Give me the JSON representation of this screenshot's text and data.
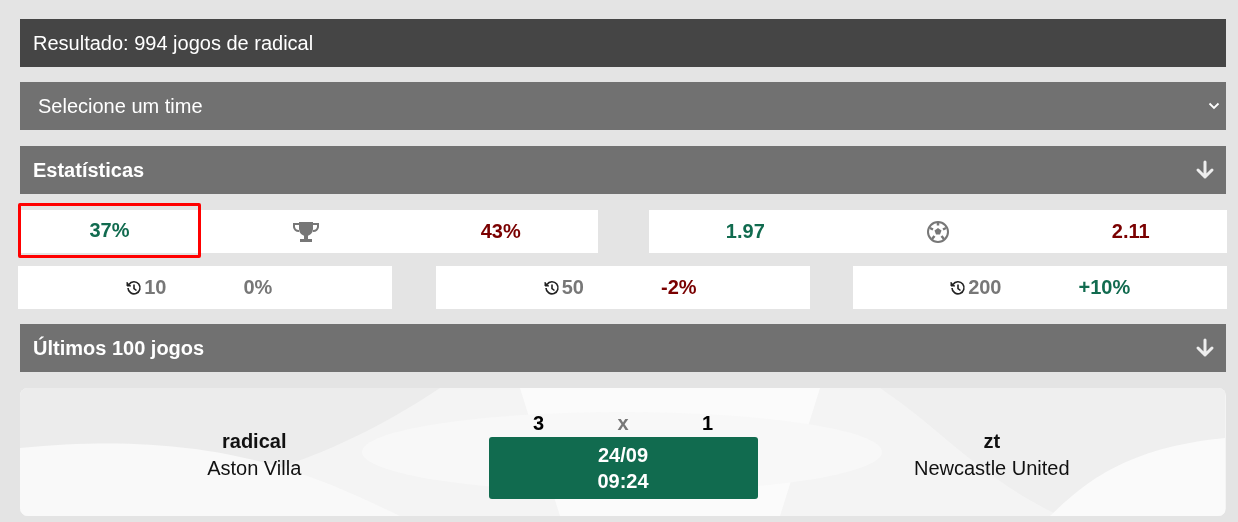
{
  "result_bar": {
    "title": "Resultado: 994 jogos de radical"
  },
  "team_select": {
    "placeholder": "Selecione um time"
  },
  "statistics": {
    "title": "Estatísticas",
    "main": [
      {
        "kind": "trophy",
        "home": {
          "value": "37%",
          "color": "#116b4f",
          "highlighted": true
        },
        "away": {
          "value": "43%",
          "color": "#7a0000",
          "highlighted": false
        }
      },
      {
        "kind": "ball",
        "home": {
          "value": "1.97",
          "color": "#116b4f",
          "highlighted": false
        },
        "away": {
          "value": "2.11",
          "color": "#7a0000",
          "highlighted": false
        }
      }
    ],
    "history": [
      {
        "label": "10",
        "value": "0%",
        "color": "#777777"
      },
      {
        "label": "50",
        "value": "-2%",
        "color": "#7a0000"
      },
      {
        "label": "200",
        "value": "+10%",
        "color": "#116b4f"
      }
    ]
  },
  "last_games": {
    "title": "Últimos 100 jogos",
    "matches": [
      {
        "home_player": "radical",
        "home_team": "Aston Villa",
        "home_score": "3",
        "separator": "x",
        "away_score": "1",
        "date": "24/09",
        "time": "09:24",
        "away_player": "zt",
        "away_team": "Newcastle United"
      }
    ]
  }
}
